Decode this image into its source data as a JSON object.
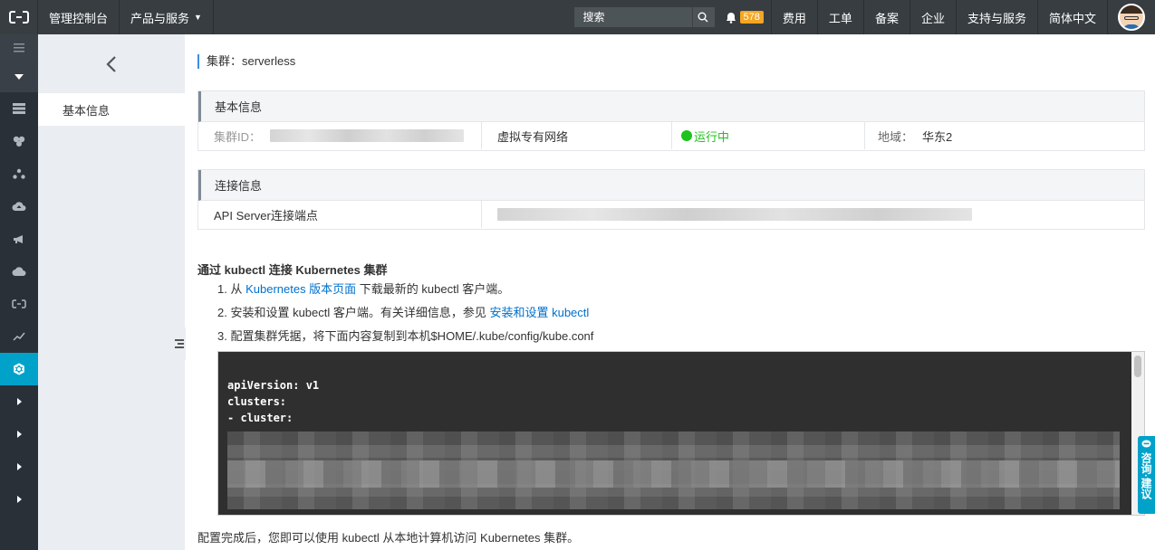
{
  "topbar": {
    "console_label": "管理控制台",
    "products_label": "产品与服务",
    "search_placeholder": "搜索",
    "notification_count": "578",
    "nav": [
      "费用",
      "工单",
      "备案",
      "企业",
      "支持与服务",
      "简体中文"
    ]
  },
  "subsidebar": {
    "items": [
      {
        "label": "基本信息"
      }
    ]
  },
  "main": {
    "cluster_label": "集群：serverless",
    "basic_info": {
      "title": "基本信息",
      "cluster_id_label": "集群ID：",
      "network": "虚拟专有网络",
      "status": "运行中",
      "region_label": "地域：",
      "region_value": "华东2"
    },
    "connection_info": {
      "title": "连接信息",
      "api_label": "API Server连接端点"
    },
    "kubectl": {
      "title": "通过 kubectl 连接 Kubernetes 集群",
      "step1_prefix": "1. 从 ",
      "step1_link": "Kubernetes 版本页面",
      "step1_suffix": " 下载最新的 kubectl 客户端。",
      "step2_prefix": "2. 安装和设置 kubectl 客户端。有关详细信息，参见 ",
      "step2_link": "安装和设置 kubectl",
      "step3": "3. 配置集群凭据，将下面内容复制到本机$HOME/.kube/config/kube.conf"
    },
    "code_lines": [
      "apiVersion: v1",
      "clusters:",
      "- cluster:"
    ],
    "footer_note": "配置完成后，您即可以使用 kubectl 从本地计算机访问 Kubernetes 集群。"
  },
  "feedback": {
    "label": "咨询·建议"
  },
  "colors": {
    "topbar": "#373d41",
    "iconbar": "#293038",
    "accent": "#00a2ca",
    "link": "#0070cc",
    "status_green": "#1ec31e",
    "badge": "#f5a623"
  }
}
